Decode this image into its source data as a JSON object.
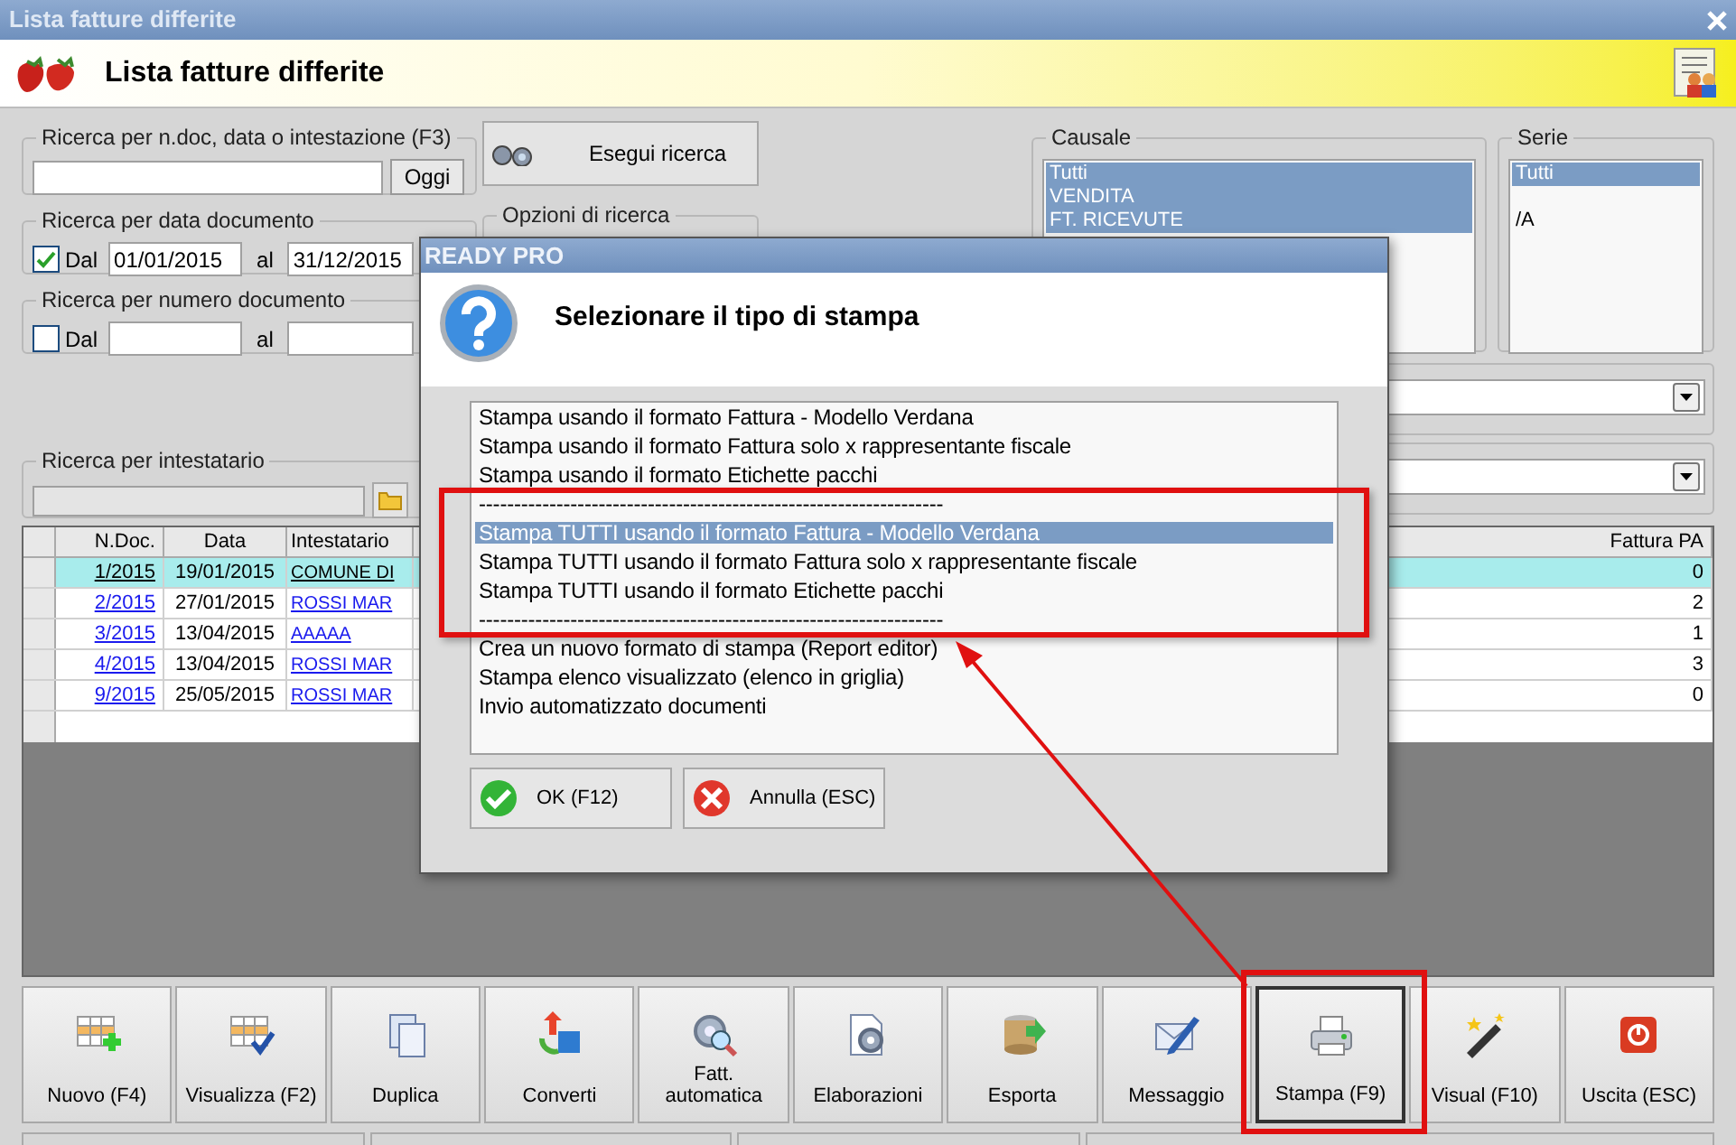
{
  "window": {
    "title": "Lista fatture differite"
  },
  "header": {
    "title": "Lista fatture differite"
  },
  "text_search": {
    "legend": "Ricerca per n.doc, data o intestazione (F3)",
    "today_button": "Oggi"
  },
  "search_button": "Esegui ricerca",
  "date_search": {
    "legend": "Ricerca per data documento",
    "checkbox": {
      "label": "Dal",
      "checked": true
    },
    "from": "01/01/2015",
    "to_label": "al",
    "to": "31/12/2015"
  },
  "options": {
    "legend": "Opzioni di ricerca"
  },
  "number_search": {
    "legend": "Ricerca per numero documento",
    "checkbox": {
      "label": "Dal",
      "checked": false
    },
    "to_label": "al"
  },
  "holder_search": {
    "legend": "Ricerca per intestatario"
  },
  "causale": {
    "legend": "Causale",
    "items": [
      {
        "label": "Tutti",
        "selected": true
      },
      {
        "label": "VENDITA",
        "selected": true
      },
      {
        "label": "FT. RICEVUTE",
        "selected": true
      }
    ]
  },
  "serie": {
    "legend": "Serie",
    "items": [
      {
        "kind": "text",
        "label": "Tutti",
        "selected": true
      },
      {
        "kind": "blank"
      },
      {
        "kind": "text",
        "label": "/A",
        "selected": false
      }
    ]
  },
  "table": {
    "columns": [
      "N.Doc.",
      "Data",
      "Intestatario",
      "Fattura PA"
    ],
    "rows": [
      {
        "selected": true,
        "cells": [
          "1/2015",
          "19/01/2015",
          "COMUNE DI",
          "0"
        ]
      },
      {
        "selected": false,
        "cells": [
          "2/2015",
          "27/01/2015",
          "ROSSI MAR",
          "2"
        ]
      },
      {
        "selected": false,
        "cells": [
          "3/2015",
          "13/04/2015",
          "AAAAA",
          "1"
        ]
      },
      {
        "selected": false,
        "cells": [
          "4/2015",
          "13/04/2015",
          "ROSSI MAR",
          "3"
        ]
      },
      {
        "selected": false,
        "cells": [
          "9/2015",
          "25/05/2015",
          "ROSSI MAR",
          "0"
        ]
      }
    ]
  },
  "dialog": {
    "title": "READY PRO",
    "heading": "Selezionare il tipo di stampa",
    "items": [
      {
        "label": "Stampa usando il formato Fattura - Modello Verdana",
        "selected": false
      },
      {
        "label": "Stampa usando il formato Fattura solo x rappresentante fiscale",
        "selected": false
      },
      {
        "label": "Stampa usando il formato Etichette pacchi",
        "selected": false
      },
      {
        "label": "------------------------------------------------------------------",
        "selected": false
      },
      {
        "label": "Stampa TUTTI usando il formato Fattura - Modello Verdana",
        "selected": true
      },
      {
        "label": "Stampa TUTTI usando il formato Fattura solo x rappresentante fiscale",
        "selected": false
      },
      {
        "label": "Stampa TUTTI usando il formato Etichette pacchi",
        "selected": false
      },
      {
        "label": "------------------------------------------------------------------",
        "selected": false
      },
      {
        "label": "Crea un nuovo formato di stampa (Report editor)",
        "selected": false
      },
      {
        "label": "Stampa elenco visualizzato (elenco in griglia)",
        "selected": false
      },
      {
        "label": "Invio automatizzato documenti",
        "selected": false
      }
    ],
    "buttons": [
      {
        "kind": "ok",
        "label": "OK (F12)"
      },
      {
        "kind": "cancel",
        "label": "Annulla (ESC)"
      }
    ]
  },
  "toolbar": [
    {
      "label": "Nuovo (F4)",
      "selected": false
    },
    {
      "label": "Visualizza (F2)",
      "selected": false
    },
    {
      "label": "Duplica",
      "selected": false
    },
    {
      "label": "Converti",
      "selected": false
    },
    {
      "label": "Fatt.\nautomatica",
      "selected": false
    },
    {
      "label": "Elaborazioni",
      "selected": false
    },
    {
      "label": "Esporta",
      "selected": false
    },
    {
      "label": "Messaggio",
      "selected": false
    },
    {
      "label": "Stampa (F9)",
      "selected": true
    },
    {
      "label": "Visual (F10)",
      "selected": false
    },
    {
      "label": "Uscita (ESC)",
      "selected": false
    }
  ]
}
